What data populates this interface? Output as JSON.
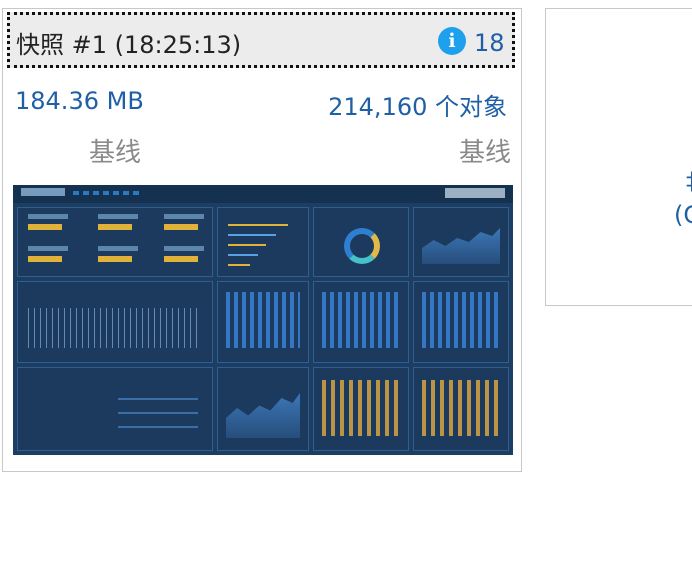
{
  "snapshot": {
    "title": "快照 #1  (18:25:13)",
    "info_icon": "info-icon",
    "info_count": "18",
    "memory_size": "184.36 MB",
    "memory_label": "基线",
    "object_count": "214,160 个对象",
    "object_label": "基线"
  },
  "second_card": {
    "partial_text_1": "‡",
    "partial_text_2": "(C"
  },
  "colors": {
    "accent_blue": "#1f5fa6",
    "info_icon": "#1fa0ec",
    "header_bg": "#ececec",
    "muted_text": "#8a8a8a",
    "thumbnail_bg": "#1d3d63"
  }
}
